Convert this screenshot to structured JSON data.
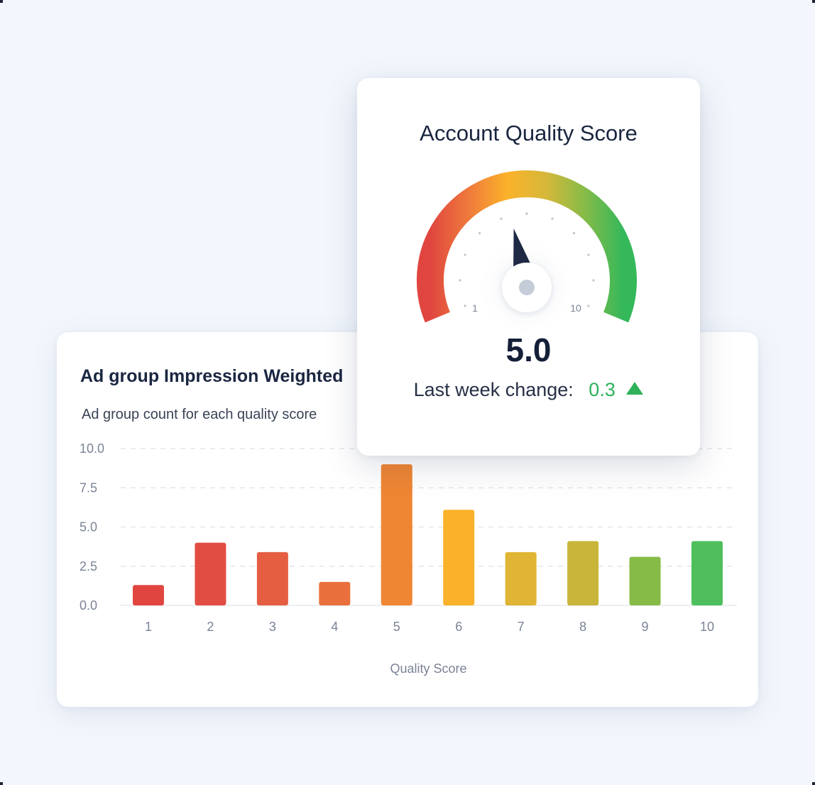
{
  "bar_card": {
    "title": "Ad group Impression Weighted",
    "subtitle": "Ad group count for each quality score"
  },
  "gauge_card": {
    "title": "Account Quality Score",
    "value_text": "5.0",
    "change_label": "Last week change:",
    "change_value": "0.3",
    "change_icon": "triangle-up-icon",
    "min_label": "1",
    "max_label": "10",
    "gauge_value": 5.0,
    "gauge_min": 1,
    "gauge_max": 10
  },
  "colors": {
    "background": "#f3f7fd",
    "positive": "#2fb15a",
    "needle": "#1e2a44",
    "gauge_gradient": [
      "#e0463f",
      "#ef7a3c",
      "#fbb22a",
      "#d6b83a",
      "#86bb48",
      "#34b85a"
    ]
  },
  "chart_data": {
    "type": "bar",
    "title": "Ad group Impression Weighted",
    "subtitle": "Ad group count for each quality score",
    "xlabel": "Quality Score",
    "ylabel": "",
    "categories": [
      "1",
      "2",
      "3",
      "4",
      "5",
      "6",
      "7",
      "8",
      "9",
      "10"
    ],
    "values": [
      1.3,
      4.0,
      3.4,
      1.5,
      9.0,
      6.1,
      3.4,
      4.1,
      3.1,
      4.1
    ],
    "bar_colors": [
      "#e0463f",
      "#e24d43",
      "#e55e42",
      "#e9703c",
      "#ef8634",
      "#fbb22a",
      "#e0b535",
      "#c8b53a",
      "#86bb48",
      "#4ebf5c"
    ],
    "ylim": [
      0,
      10
    ],
    "yticks": [
      "0.0",
      "2.5",
      "5.0",
      "7.5",
      "10.0"
    ],
    "ytick_values": [
      0,
      2.5,
      5,
      7.5,
      10
    ],
    "grid": true,
    "legend": "none"
  }
}
